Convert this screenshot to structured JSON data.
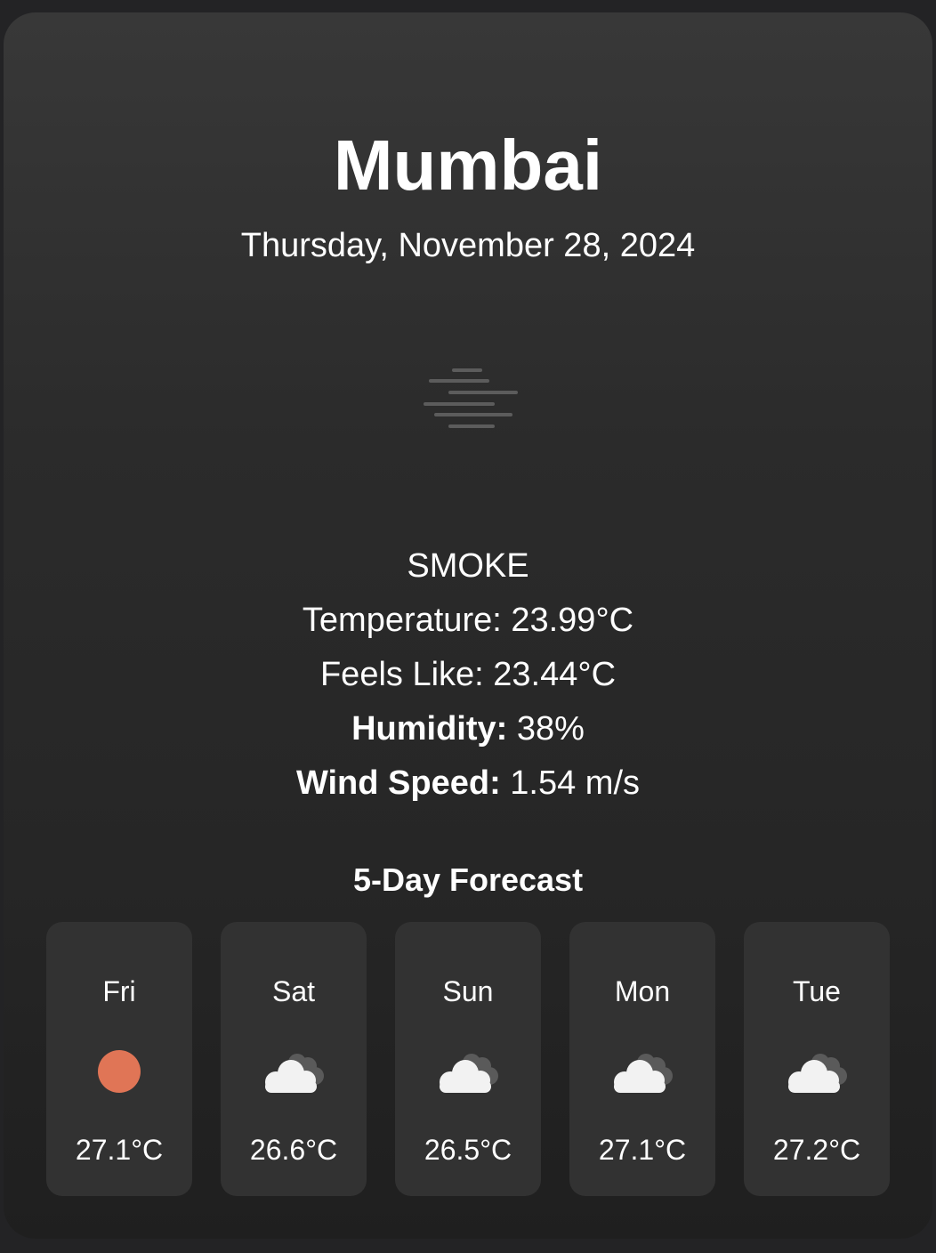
{
  "current": {
    "city": "Mumbai",
    "date": "Thursday, November 28, 2024",
    "icon": "smoke-icon",
    "condition": "SMOKE",
    "temperature_text": "Temperature: 23.99°C",
    "feels_like_text": "Feels Like: 23.44°C",
    "humidity_label": "Humidity:",
    "humidity_value": " 38%",
    "wind_label": "Wind Speed:",
    "wind_value": " 1.54 m/s"
  },
  "forecast": {
    "title": "5-Day Forecast",
    "days": [
      {
        "day": "Fri",
        "icon": "sun-icon",
        "temp": "27.1°C"
      },
      {
        "day": "Sat",
        "icon": "cloud-icon",
        "temp": "26.6°C"
      },
      {
        "day": "Sun",
        "icon": "cloud-icon",
        "temp": "26.5°C"
      },
      {
        "day": "Mon",
        "icon": "cloud-icon",
        "temp": "27.1°C"
      },
      {
        "day": "Tue",
        "icon": "cloud-icon",
        "temp": "27.2°C"
      }
    ]
  },
  "colors": {
    "sun": "#e07556",
    "cloud": "#f2f2f2",
    "cloud_back": "#5a5a5a",
    "smoke_lines": "#5c5c5c"
  }
}
